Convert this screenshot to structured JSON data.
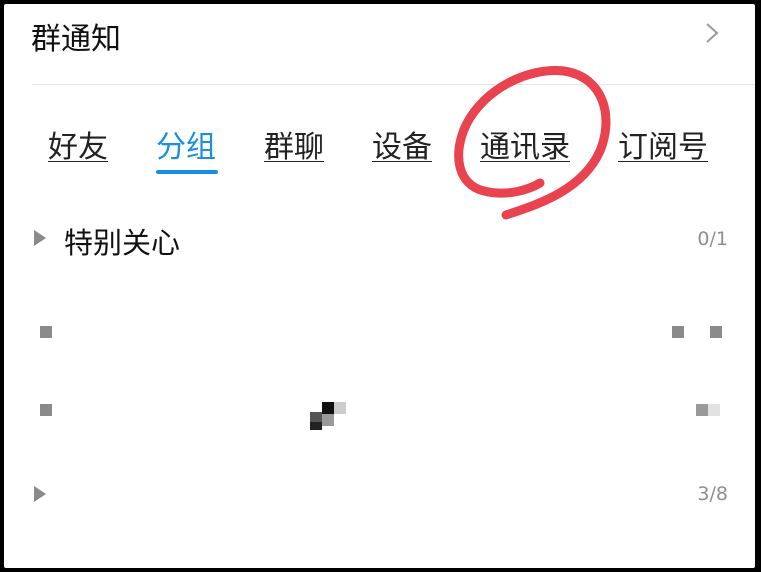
{
  "header": {
    "title": "群通知"
  },
  "tabs": [
    {
      "label": "好友",
      "active": false
    },
    {
      "label": "分组",
      "active": true
    },
    {
      "label": "群聊",
      "active": false
    },
    {
      "label": "设备",
      "active": false
    },
    {
      "label": "通讯录",
      "active": false
    },
    {
      "label": "订阅号",
      "active": false
    }
  ],
  "groups": [
    {
      "name": "特别关心",
      "count": "0/1"
    },
    {
      "name": "",
      "count": ""
    },
    {
      "name": "",
      "count": ""
    },
    {
      "name": "",
      "count": "3/8"
    }
  ],
  "colors": {
    "accent": "#1a8fe0",
    "annotation": "#e8434f"
  },
  "icons": {
    "header_arrow": "chevron-right-icon",
    "group_expand": "triangle-right-icon"
  }
}
